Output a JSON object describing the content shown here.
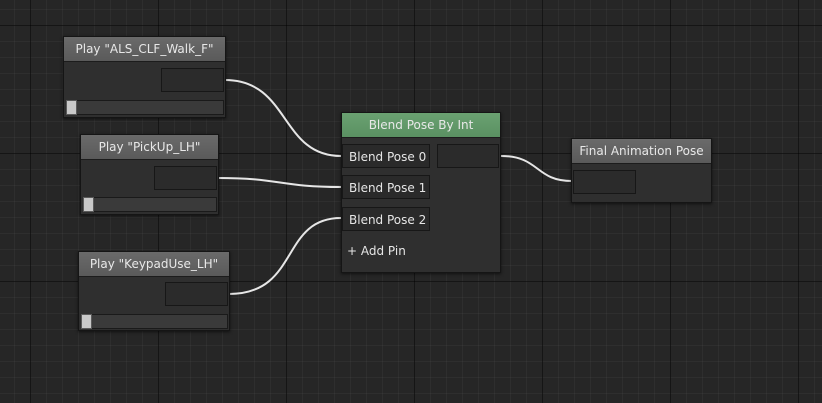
{
  "graph": {
    "nodes": {
      "play_walk": {
        "title": "Play \"ALS_CLF_Walk_F\""
      },
      "play_pickup": {
        "title": "Play \"PickUp_LH\""
      },
      "play_keypad": {
        "title": "Play \"KeypadUse_LH\""
      },
      "blend": {
        "title": "Blend Pose By Int",
        "pins": [
          "Blend Pose 0",
          "Blend Pose 1",
          "Blend Pose 2"
        ],
        "add_pin_label": "+ Add Pin"
      },
      "final": {
        "title": "Final Animation Pose"
      }
    }
  },
  "colors": {
    "blend_header": "#5f9a67",
    "node_header": "#626262",
    "wire": "#e6e6e6",
    "background": "#262626"
  }
}
